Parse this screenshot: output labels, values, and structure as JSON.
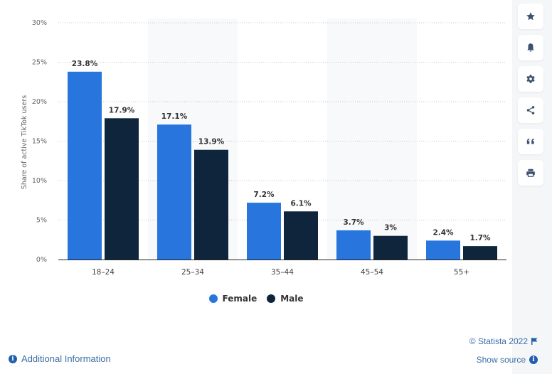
{
  "chart_data": {
    "type": "bar",
    "title": "",
    "xlabel": "",
    "ylabel": "Share of active TikTok users",
    "ylim": [
      0,
      30
    ],
    "yticks": [
      0,
      5,
      10,
      15,
      20,
      25,
      30
    ],
    "ytick_labels": [
      "0%",
      "5%",
      "10%",
      "15%",
      "20%",
      "25%",
      "30%"
    ],
    "grid": true,
    "legend_position": "bottom-center",
    "categories": [
      "18-24",
      "25-34",
      "35-44",
      "45-54",
      "55+"
    ],
    "series": [
      {
        "name": "Female",
        "color": "#2876dd",
        "values": [
          23.8,
          17.1,
          7.2,
          3.7,
          2.4
        ],
        "labels": [
          "23.8%",
          "17.1%",
          "7.2%",
          "3.7%",
          "2.4%"
        ]
      },
      {
        "name": "Male",
        "color": "#0f253c",
        "values": [
          17.9,
          13.9,
          6.1,
          3.0,
          1.7
        ],
        "labels": [
          "17.9%",
          "13.9%",
          "6.1%",
          "3%",
          "1.7%"
        ]
      }
    ]
  },
  "legend": {
    "items": [
      {
        "label": "Female",
        "color": "#2876dd"
      },
      {
        "label": "Male",
        "color": "#0f253c"
      }
    ]
  },
  "sidebar": {
    "buttons": [
      {
        "name": "favorite",
        "icon": "star-icon"
      },
      {
        "name": "notification",
        "icon": "bell-icon"
      },
      {
        "name": "settings",
        "icon": "gear-icon"
      },
      {
        "name": "share",
        "icon": "share-icon"
      },
      {
        "name": "cite",
        "icon": "quote-icon"
      },
      {
        "name": "print",
        "icon": "printer-icon"
      }
    ]
  },
  "footer": {
    "additional_info": "Additional Information",
    "copyright": "© Statista 2022",
    "show_source": "Show source"
  }
}
